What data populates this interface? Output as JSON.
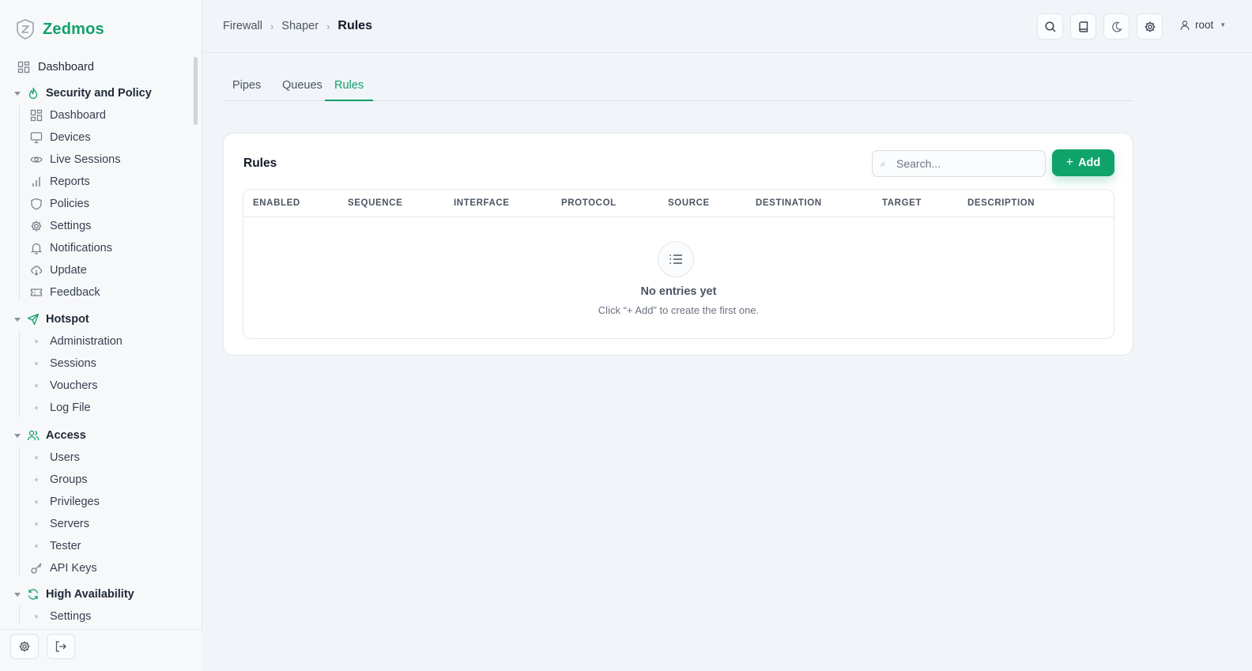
{
  "brand": {
    "name": "Zedmos"
  },
  "sidebar": {
    "top_item": {
      "label": "Dashboard",
      "icon": "grid-icon"
    },
    "sections": [
      {
        "label": "Security and Policy",
        "icon": "flame-icon",
        "items": [
          {
            "label": "Dashboard",
            "icon": "grid-icon"
          },
          {
            "label": "Devices",
            "icon": "monitor-icon"
          },
          {
            "label": "Live Sessions",
            "icon": "eye-icon"
          },
          {
            "label": "Reports",
            "icon": "bar-chart-icon"
          },
          {
            "label": "Policies",
            "icon": "shield-icon"
          },
          {
            "label": "Settings",
            "icon": "gear-icon"
          },
          {
            "label": "Notifications",
            "icon": "bell-icon"
          },
          {
            "label": "Update",
            "icon": "cloud-download-icon"
          },
          {
            "label": "Feedback",
            "icon": "ticket-icon"
          }
        ]
      },
      {
        "label": "Hotspot",
        "icon": "send-icon",
        "items": [
          {
            "label": "Administration"
          },
          {
            "label": "Sessions"
          },
          {
            "label": "Vouchers"
          },
          {
            "label": "Log File"
          }
        ]
      },
      {
        "label": "Access",
        "icon": "users-icon",
        "items": [
          {
            "label": "Users"
          },
          {
            "label": "Groups"
          },
          {
            "label": "Privileges"
          },
          {
            "label": "Servers"
          },
          {
            "label": "Tester"
          },
          {
            "label": "API Keys",
            "icon": "key-icon"
          }
        ]
      },
      {
        "label": "High Availability",
        "icon": "refresh-icon",
        "items": [
          {
            "label": "Settings"
          }
        ]
      }
    ]
  },
  "breadcrumb": {
    "items": [
      "Firewall",
      "Shaper"
    ],
    "current": "Rules"
  },
  "header": {
    "user": "root"
  },
  "tabs": [
    {
      "label": "Pipes",
      "active": false
    },
    {
      "label": "Queues",
      "active": false
    },
    {
      "label": "Rules",
      "active": true
    }
  ],
  "card": {
    "title": "Rules",
    "search_placeholder": "Search...",
    "add_label": "Add",
    "columns": [
      "ENABLED",
      "SEQUENCE",
      "INTERFACE",
      "PROTOCOL",
      "SOURCE",
      "DESTINATION",
      "TARGET",
      "DESCRIPTION"
    ],
    "empty_title": "No entries yet",
    "empty_subtitle": "Click “+ Add” to create the first one."
  },
  "colors": {
    "accent": "#12a06a",
    "button": "#10a36c"
  }
}
